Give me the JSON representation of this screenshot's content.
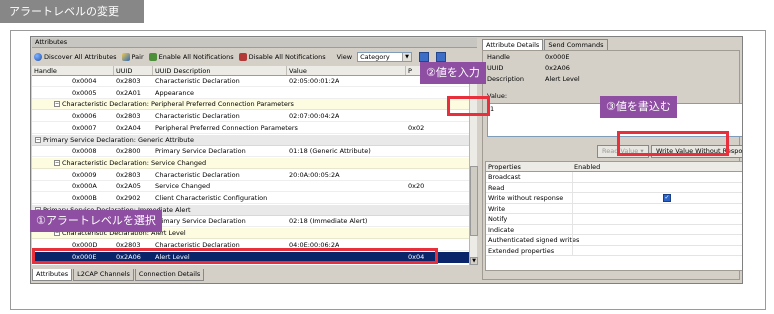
{
  "slide_title": "アラートレベルの変更",
  "left_panel": {
    "title": "Attributes",
    "toolbar": {
      "discover": "Discover All Attributes",
      "pair": "Pair",
      "enable": "Enable All Notifications",
      "disable": "Disable All Notifications",
      "view_label": "View",
      "view_value": "Category"
    },
    "columns": {
      "handle": "Handle",
      "uuid": "UUID",
      "uuid_desc": "UUID Description",
      "value": "Value",
      "props": "P"
    },
    "rows": [
      {
        "kind": "attr",
        "handle": "0x0004",
        "uuid": "0x2803",
        "desc": "Characteristic Declaration",
        "value": "02:05:00:01:2A",
        "p": ""
      },
      {
        "kind": "attr",
        "handle": "0x0005",
        "uuid": "0x2A01",
        "desc": "Appearance",
        "value": "",
        "p": ""
      },
      {
        "kind": "chr",
        "text": "Characteristic Declaration: Peripheral Preferred Connection Parameters"
      },
      {
        "kind": "attr",
        "handle": "0x0006",
        "uuid": "0x2803",
        "desc": "Characteristic Declaration",
        "value": "02:07:00:04:2A",
        "p": ""
      },
      {
        "kind": "attr",
        "handle": "0x0007",
        "uuid": "0x2A04",
        "desc": "Peripheral Preferred Connection Parameters",
        "value": "",
        "p": "0x02"
      },
      {
        "kind": "svc",
        "text": "Primary Service Declaration: Generic Attribute"
      },
      {
        "kind": "attr",
        "handle": "0x0008",
        "uuid": "0x2800",
        "desc": "Primary Service Declaration",
        "value": "01:18 (Generic Attribute)",
        "p": ""
      },
      {
        "kind": "chr",
        "text": "Characteristic Declaration: Service Changed"
      },
      {
        "kind": "attr",
        "handle": "0x0009",
        "uuid": "0x2803",
        "desc": "Characteristic Declaration",
        "value": "20:0A:00:05:2A",
        "p": ""
      },
      {
        "kind": "attr",
        "handle": "0x000A",
        "uuid": "0x2A05",
        "desc": "Service Changed",
        "value": "",
        "p": "0x20"
      },
      {
        "kind": "attr",
        "handle": "0x000B",
        "uuid": "0x2902",
        "desc": "Client Characteristic Configuration",
        "value": "",
        "p": ""
      },
      {
        "kind": "svc",
        "text": "Primary Service Declaration: Immediate Alert"
      },
      {
        "kind": "attr",
        "handle": "0x000C",
        "uuid": "0x2800",
        "desc": "Primary Service Declaration",
        "value": "02:18 (Immediate Alert)",
        "p": ""
      },
      {
        "kind": "chr",
        "text": "Characteristic Declaration: Alert Level"
      },
      {
        "kind": "attr",
        "handle": "0x000D",
        "uuid": "0x2803",
        "desc": "Characteristic Declaration",
        "value": "04:0E:00:06:2A",
        "p": ""
      },
      {
        "kind": "sel",
        "handle": "0x000E",
        "uuid": "0x2A06",
        "desc": "Alert Level",
        "value": "",
        "p": "0x04"
      }
    ],
    "bottom_tabs": [
      "Attributes",
      "L2CAP Channels",
      "Connection Details"
    ]
  },
  "right_panel": {
    "tabs": [
      "Attribute Details",
      "Send Commands"
    ],
    "handle_label": "Handle",
    "handle_value": "0x000E",
    "uuid_label": "UUID",
    "uuid_value": "0x2A06",
    "desc_label": "Description",
    "desc_value": "Alert Level",
    "value_label": "Value:",
    "value_text": "1",
    "read_button": "Read Value",
    "write_button": "Write Value Without Response",
    "props_headers": {
      "properties": "Properties",
      "enabled": "Enabled"
    },
    "properties": [
      {
        "name": "Broadcast",
        "enabled": false
      },
      {
        "name": "Read",
        "enabled": false
      },
      {
        "name": "Write without response",
        "enabled": true
      },
      {
        "name": "Write",
        "enabled": false
      },
      {
        "name": "Notify",
        "enabled": false
      },
      {
        "name": "Indicate",
        "enabled": false
      },
      {
        "name": "Authenticated signed writes",
        "enabled": false
      },
      {
        "name": "Extended properties",
        "enabled": false
      }
    ]
  },
  "callouts": {
    "step1": "①アラートレベルを選択",
    "step2": "②値を入力",
    "step3": "③値を書込む"
  },
  "colors": {
    "callout": "#8e4fa2",
    "highlight": "#e8303c",
    "selection": "#0a246a"
  },
  "icons": [
    "discover-icon",
    "pair-icon",
    "enable-notifications-icon",
    "disable-notifications-icon",
    "checkbox-checked-icon"
  ]
}
